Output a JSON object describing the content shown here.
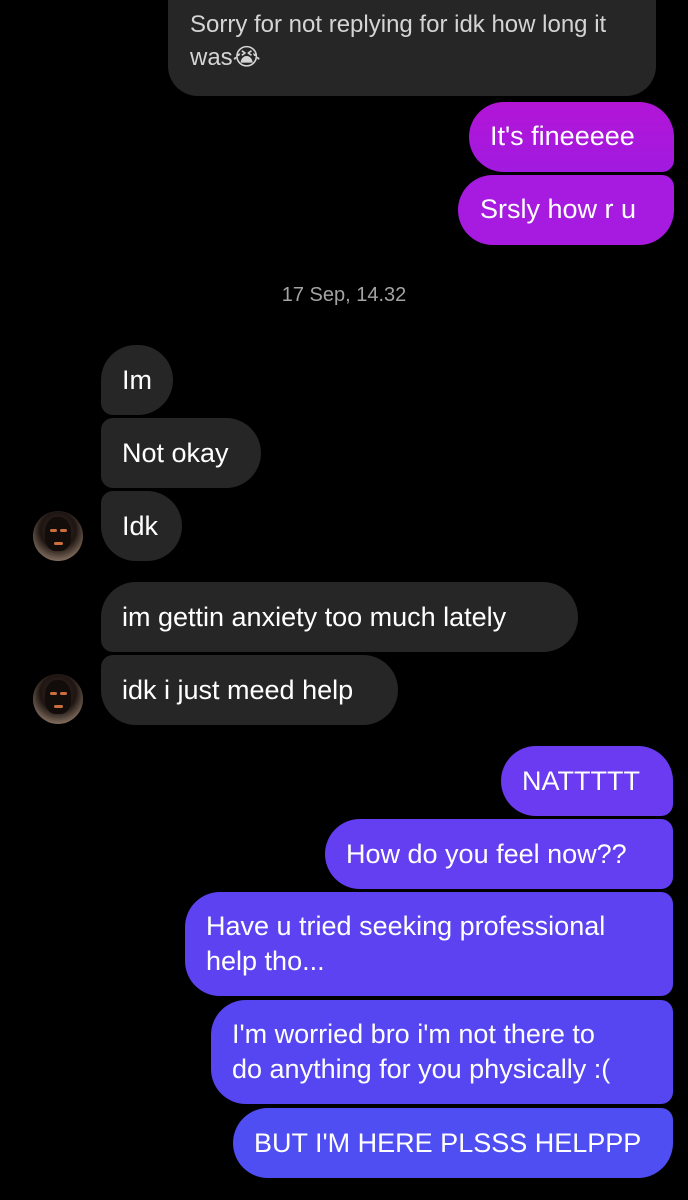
{
  "conversation": {
    "top_incoming": {
      "line1": "Sorry for not replying for idk how long it",
      "line2": "was😭"
    },
    "outgoing_pink": [
      "It's fineeeee",
      "Srsly how r u"
    ],
    "timestamp": "17 Sep, 14.32",
    "incoming_group1": [
      "Im",
      "Not okay",
      "Idk"
    ],
    "incoming_group2": [
      "im gettin anxiety too much lately",
      "idk i just meed help"
    ],
    "outgoing_purple": {
      "m1": "NATTTTT",
      "m2": "How do you feel now??",
      "m3_line1": "Have u tried seeking professional",
      "m3_line2": "help tho...",
      "m4_line1": "I'm worried bro i'm not there to",
      "m4_line2": "do anything for you physically :(",
      "m5": "BUT I'M HERE PLSSS HELPPP"
    }
  },
  "colors": {
    "background": "#000000",
    "incoming_bubble": "#262626",
    "outgoing_pink": "#b215d6",
    "outgoing_purple_top": "#6a3bf0",
    "outgoing_purple_bottom": "#4e4ef2",
    "timestamp_text": "#a3a3a3"
  },
  "icons": {
    "avatar": "contact-avatar-icon"
  }
}
